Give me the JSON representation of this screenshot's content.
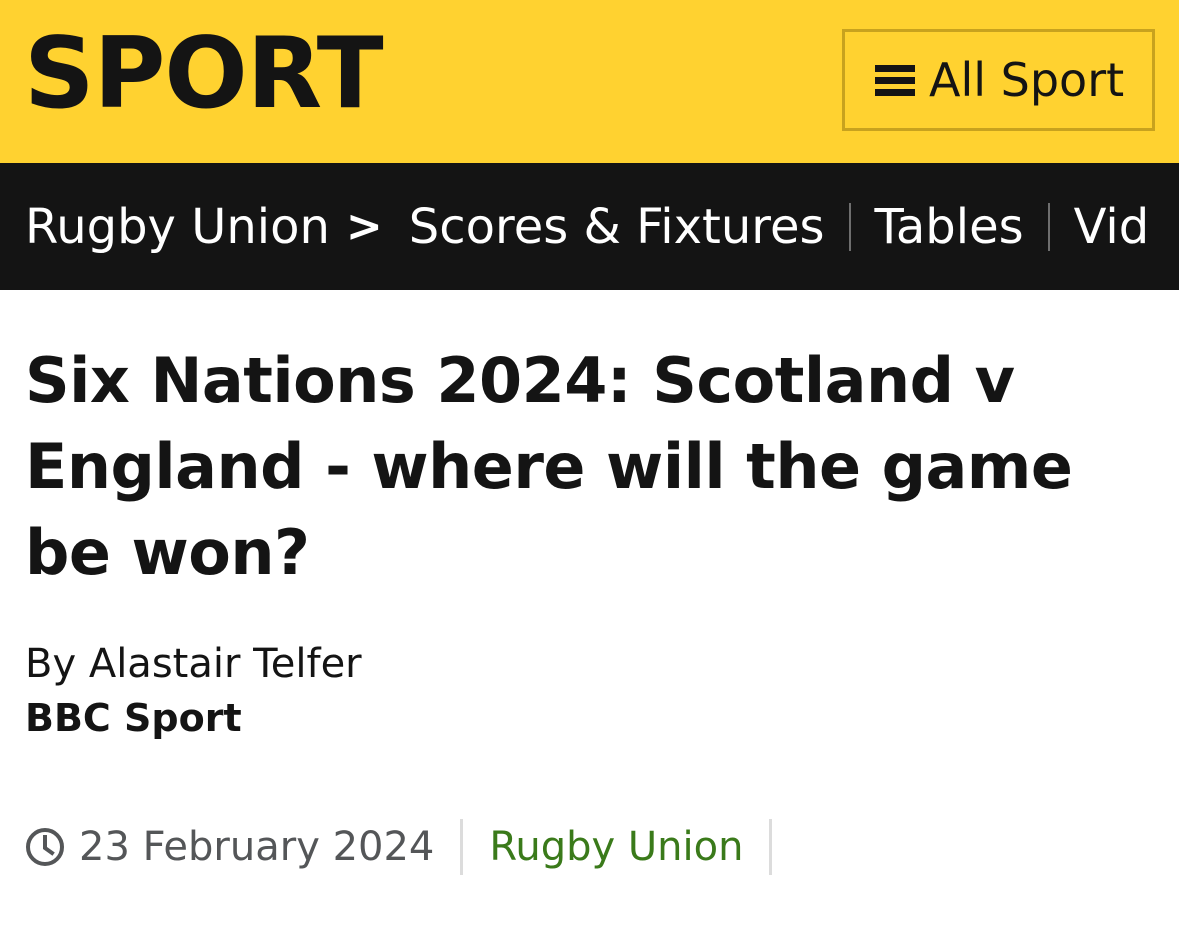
{
  "masthead": {
    "logo_text": "SPORT",
    "menu_button_label": "All Sport",
    "menu_icon": "hamburger-menu-icon",
    "background_color": "#ffd230"
  },
  "section_nav": {
    "section": "Rugby Union",
    "chevron": ">",
    "items": [
      {
        "label": "Scores & Fixtures"
      },
      {
        "label": "Tables"
      },
      {
        "label": "Vid"
      }
    ],
    "background_color": "#141414"
  },
  "article": {
    "headline": "Six Nations 2024: Scotland v England - where will the game be won?",
    "byline_author": "By Alastair Telfer",
    "byline_org": "BBC Sport",
    "date": "23 February 2024",
    "date_icon": "clock-icon",
    "topic": "Rugby Union",
    "topic_color": "#3a7a1a"
  }
}
